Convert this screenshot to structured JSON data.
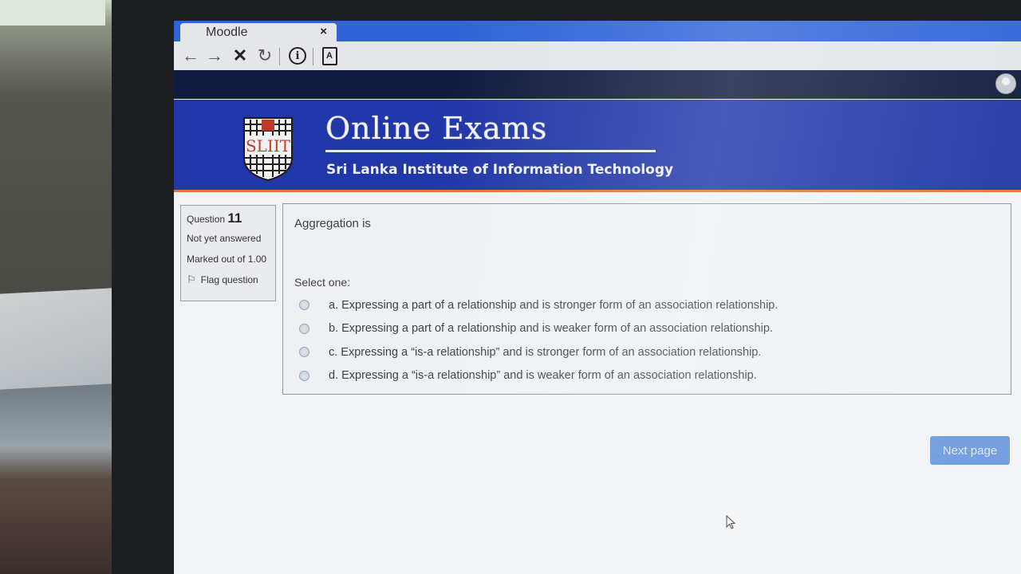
{
  "browser": {
    "tab_title": "Moodle",
    "tab_close": "×"
  },
  "toolbar": {
    "back_icon": "←",
    "forward_icon": "→",
    "stop_icon": "✕",
    "reload_icon": "↻",
    "info_icon": "i",
    "reader_icon": "A"
  },
  "banner": {
    "crest_text": "SLIIT",
    "title": "Online Exams",
    "subtitle": "Sri Lanka Institute of Information Technology",
    "background_color": "#2136a8",
    "accent_color": "#e0733a"
  },
  "question_info": {
    "label": "Question",
    "number": "11",
    "state": "Not yet answered",
    "grade": "Marked out of 1.00",
    "flag_label": "Flag question"
  },
  "question": {
    "text": "Aggregation is",
    "prompt": "Select one:",
    "answers": [
      {
        "label": "a. Expressing a part of a relationship and is stronger form of an association relationship.",
        "selected": false
      },
      {
        "label": "b. Expressing a part of a relationship and is weaker form of an association relationship.",
        "selected": false
      },
      {
        "label": "c. Expressing a “is-a relationship” and is stronger form of an association relationship.",
        "selected": false
      },
      {
        "label": "d. Expressing a “is-a relationship” and is weaker form of an association relationship.",
        "selected": false
      }
    ]
  },
  "navigation": {
    "next_label": "Next page"
  }
}
